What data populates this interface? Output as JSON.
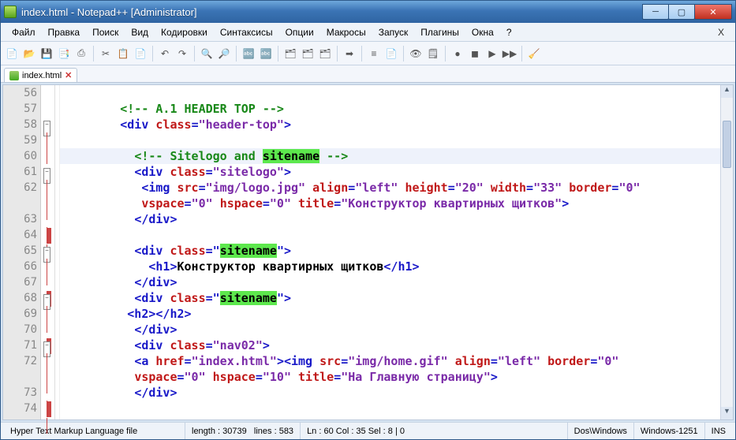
{
  "window": {
    "title": "index.html - Notepad++ [Administrator]"
  },
  "menu": {
    "items": [
      "Файл",
      "Правка",
      "Поиск",
      "Вид",
      "Кодировки",
      "Синтаксисы",
      "Опции",
      "Макросы",
      "Запуск",
      "Плагины",
      "Окна",
      "?"
    ],
    "close_x": "X"
  },
  "toolbar": {
    "icons": [
      "📄",
      "📂",
      "💾",
      "📑",
      "⎙",
      "",
      "✂",
      "📋",
      "📄",
      "",
      "↶",
      "↷",
      "",
      "🔍",
      "🔎",
      "",
      "🔤",
      "🔤",
      "",
      "🗂",
      "🗂",
      "🗂",
      "",
      "➡",
      "",
      "≡",
      "📄",
      "",
      "👁",
      "🗒",
      "",
      "●",
      "◼",
      "▶",
      "▶▶",
      "",
      "🧹"
    ]
  },
  "tabs": {
    "items": [
      {
        "label": "index.html"
      }
    ],
    "close_x": "✕"
  },
  "editor": {
    "first_line": 56,
    "highlight_line": 60,
    "lines": [
      {
        "n": 56,
        "fold": "",
        "seg": []
      },
      {
        "n": 57,
        "fold": "",
        "seg": [
          {
            "c": "sc-text",
            "t": "        "
          },
          {
            "c": "sc-comment",
            "t": "<!-- A.1 HEADER TOP -->"
          }
        ]
      },
      {
        "n": 58,
        "fold": "box",
        "seg": [
          {
            "c": "sc-text",
            "t": "        "
          },
          {
            "c": "sc-tag",
            "t": "<div"
          },
          {
            "c": "sc-text",
            "t": " "
          },
          {
            "c": "sc-attr",
            "t": "class"
          },
          {
            "c": "sc-tag",
            "t": "="
          },
          {
            "c": "sc-str",
            "t": "\"header-top\""
          },
          {
            "c": "sc-tag",
            "t": ">"
          }
        ]
      },
      {
        "n": 59,
        "fold": "v",
        "seg": []
      },
      {
        "n": 60,
        "fold": "v",
        "seg": [
          {
            "c": "sc-text",
            "t": "          "
          },
          {
            "c": "sc-comment",
            "t": "<!-- Sitelogo and "
          },
          {
            "c": "sc-hl",
            "t": "sitename"
          },
          {
            "c": "sc-comment",
            "t": " -->"
          }
        ]
      },
      {
        "n": 61,
        "fold": "box",
        "seg": [
          {
            "c": "sc-text",
            "t": "          "
          },
          {
            "c": "sc-tag",
            "t": "<div"
          },
          {
            "c": "sc-text",
            "t": " "
          },
          {
            "c": "sc-attr",
            "t": "class"
          },
          {
            "c": "sc-tag",
            "t": "="
          },
          {
            "c": "sc-str",
            "t": "\"sitelogo\""
          },
          {
            "c": "sc-tag",
            "t": ">"
          }
        ]
      },
      {
        "n": 62,
        "fold": "v",
        "seg": [
          {
            "c": "sc-text",
            "t": "           "
          },
          {
            "c": "sc-tag",
            "t": "<img"
          },
          {
            "c": "sc-text",
            "t": " "
          },
          {
            "c": "sc-attr",
            "t": "src"
          },
          {
            "c": "sc-tag",
            "t": "="
          },
          {
            "c": "sc-str",
            "t": "\"img/logo.jpg\""
          },
          {
            "c": "sc-text",
            "t": " "
          },
          {
            "c": "sc-attr",
            "t": "align"
          },
          {
            "c": "sc-tag",
            "t": "="
          },
          {
            "c": "sc-str",
            "t": "\"left\""
          },
          {
            "c": "sc-text",
            "t": " "
          },
          {
            "c": "sc-attr",
            "t": "height"
          },
          {
            "c": "sc-tag",
            "t": "="
          },
          {
            "c": "sc-str",
            "t": "\"20\""
          },
          {
            "c": "sc-text",
            "t": " "
          },
          {
            "c": "sc-attr",
            "t": "width"
          },
          {
            "c": "sc-tag",
            "t": "="
          },
          {
            "c": "sc-str",
            "t": "\"33\""
          },
          {
            "c": "sc-text",
            "t": " "
          },
          {
            "c": "sc-attr",
            "t": "border"
          },
          {
            "c": "sc-tag",
            "t": "="
          },
          {
            "c": "sc-str",
            "t": "\"0\""
          }
        ]
      },
      {
        "n": "",
        "fold": "v",
        "seg": [
          {
            "c": "sc-text",
            "t": "           "
          },
          {
            "c": "sc-attr",
            "t": "vspace"
          },
          {
            "c": "sc-tag",
            "t": "="
          },
          {
            "c": "sc-str",
            "t": "\"0\""
          },
          {
            "c": "sc-text",
            "t": " "
          },
          {
            "c": "sc-attr",
            "t": "hspace"
          },
          {
            "c": "sc-tag",
            "t": "="
          },
          {
            "c": "sc-str",
            "t": "\"0\""
          },
          {
            "c": "sc-text",
            "t": " "
          },
          {
            "c": "sc-attr",
            "t": "title"
          },
          {
            "c": "sc-tag",
            "t": "="
          },
          {
            "c": "sc-str",
            "t": "\"Конструктор квартирных щитков\""
          },
          {
            "c": "sc-tag",
            "t": ">"
          }
        ]
      },
      {
        "n": 63,
        "fold": "end",
        "seg": [
          {
            "c": "sc-text",
            "t": "          "
          },
          {
            "c": "sc-tag",
            "t": "</div>"
          }
        ]
      },
      {
        "n": 64,
        "fold": "v",
        "seg": []
      },
      {
        "n": 65,
        "fold": "box",
        "seg": [
          {
            "c": "sc-text",
            "t": "          "
          },
          {
            "c": "sc-tag",
            "t": "<div"
          },
          {
            "c": "sc-text",
            "t": " "
          },
          {
            "c": "sc-attr",
            "t": "class"
          },
          {
            "c": "sc-tag",
            "t": "=\""
          },
          {
            "c": "sc-hl",
            "t": "sitename"
          },
          {
            "c": "sc-tag",
            "t": "\">"
          }
        ]
      },
      {
        "n": 66,
        "fold": "v",
        "seg": [
          {
            "c": "sc-text",
            "t": "            "
          },
          {
            "c": "sc-tag",
            "t": "<h1>"
          },
          {
            "c": "sc-text",
            "t": "Конструктор квартирных щитков"
          },
          {
            "c": "sc-tag",
            "t": "</h1>"
          }
        ]
      },
      {
        "n": 67,
        "fold": "end",
        "seg": [
          {
            "c": "sc-text",
            "t": "          "
          },
          {
            "c": "sc-tag",
            "t": "</div>"
          }
        ]
      },
      {
        "n": 68,
        "fold": "box",
        "seg": [
          {
            "c": "sc-text",
            "t": "          "
          },
          {
            "c": "sc-tag",
            "t": "<div"
          },
          {
            "c": "sc-text",
            "t": " "
          },
          {
            "c": "sc-attr",
            "t": "class"
          },
          {
            "c": "sc-tag",
            "t": "=\""
          },
          {
            "c": "sc-hl",
            "t": "sitename"
          },
          {
            "c": "sc-tag",
            "t": "\">"
          }
        ]
      },
      {
        "n": 69,
        "fold": "v",
        "seg": [
          {
            "c": "sc-text",
            "t": "         "
          },
          {
            "c": "sc-tag",
            "t": "<h2></h2>"
          }
        ]
      },
      {
        "n": 70,
        "fold": "end",
        "seg": [
          {
            "c": "sc-text",
            "t": "          "
          },
          {
            "c": "sc-tag",
            "t": "</div>"
          }
        ]
      },
      {
        "n": 71,
        "fold": "box",
        "seg": [
          {
            "c": "sc-text",
            "t": "          "
          },
          {
            "c": "sc-tag",
            "t": "<div"
          },
          {
            "c": "sc-text",
            "t": " "
          },
          {
            "c": "sc-attr",
            "t": "class"
          },
          {
            "c": "sc-tag",
            "t": "="
          },
          {
            "c": "sc-str",
            "t": "\"nav02\""
          },
          {
            "c": "sc-tag",
            "t": ">"
          }
        ]
      },
      {
        "n": 72,
        "fold": "v",
        "seg": [
          {
            "c": "sc-text",
            "t": "          "
          },
          {
            "c": "sc-tag",
            "t": "<a"
          },
          {
            "c": "sc-text",
            "t": " "
          },
          {
            "c": "sc-attr",
            "t": "href"
          },
          {
            "c": "sc-tag",
            "t": "="
          },
          {
            "c": "sc-str",
            "t": "\"index.html\""
          },
          {
            "c": "sc-tag",
            "t": "><img"
          },
          {
            "c": "sc-text",
            "t": " "
          },
          {
            "c": "sc-attr",
            "t": "src"
          },
          {
            "c": "sc-tag",
            "t": "="
          },
          {
            "c": "sc-str",
            "t": "\"img/home.gif\""
          },
          {
            "c": "sc-text",
            "t": " "
          },
          {
            "c": "sc-attr",
            "t": "align"
          },
          {
            "c": "sc-tag",
            "t": "="
          },
          {
            "c": "sc-str",
            "t": "\"left\""
          },
          {
            "c": "sc-text",
            "t": " "
          },
          {
            "c": "sc-attr",
            "t": "border"
          },
          {
            "c": "sc-tag",
            "t": "="
          },
          {
            "c": "sc-str",
            "t": "\"0\""
          }
        ]
      },
      {
        "n": "",
        "fold": "v",
        "seg": [
          {
            "c": "sc-text",
            "t": "          "
          },
          {
            "c": "sc-attr",
            "t": "vspace"
          },
          {
            "c": "sc-tag",
            "t": "="
          },
          {
            "c": "sc-str",
            "t": "\"0\""
          },
          {
            "c": "sc-text",
            "t": " "
          },
          {
            "c": "sc-attr",
            "t": "hspace"
          },
          {
            "c": "sc-tag",
            "t": "="
          },
          {
            "c": "sc-str",
            "t": "\"10\""
          },
          {
            "c": "sc-text",
            "t": " "
          },
          {
            "c": "sc-attr",
            "t": "title"
          },
          {
            "c": "sc-tag",
            "t": "="
          },
          {
            "c": "sc-str",
            "t": "\"На Главную страницу\""
          },
          {
            "c": "sc-tag",
            "t": ">"
          }
        ]
      },
      {
        "n": 73,
        "fold": "end",
        "seg": [
          {
            "c": "sc-text",
            "t": "          "
          },
          {
            "c": "sc-tag",
            "t": "</div>"
          }
        ]
      },
      {
        "n": 74,
        "fold": "v",
        "seg": []
      }
    ]
  },
  "status": {
    "lang": "Hyper Text Markup Language file",
    "length_label": "length : 30739",
    "lines_label": "lines : 583",
    "pos": "Ln : 60    Col : 35    Sel : 8 | 0",
    "eol": "Dos\\Windows",
    "enc": "Windows-1251",
    "mode": "INS"
  }
}
